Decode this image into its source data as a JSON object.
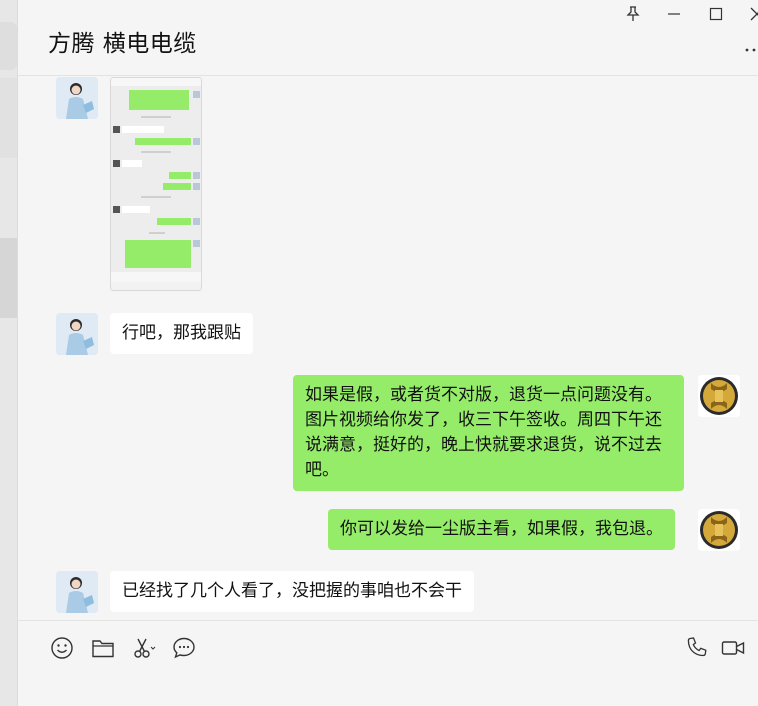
{
  "header": {
    "title": "方腾  横电电缆"
  },
  "window_controls": {
    "pin_icon": "pin-icon",
    "minimize_icon": "minimize-icon",
    "maximize_icon": "maximize-icon",
    "close_icon": "close-icon",
    "more_icon": "more-icon"
  },
  "messages": [
    {
      "side": "left",
      "type": "image",
      "sender_avatar": "girl-avatar"
    },
    {
      "side": "left",
      "type": "text",
      "text": "行吧，那我跟贴"
    },
    {
      "side": "right",
      "type": "text",
      "text": "如果是假，或者货不对版，退货一点问题没有。图片视频给你发了，收三下午签收。周四下午还说满意，挺好的，晚上快就要求退货，说不过去吧。"
    },
    {
      "side": "right",
      "type": "text",
      "text": "你可以发给一尘版主看，如果假，我包退。"
    },
    {
      "side": "left",
      "type": "text",
      "text": "已经找了几个人看了，没把握的事咱也不会干"
    }
  ],
  "toolbar": {
    "icons": [
      "emoji-icon",
      "folder-icon",
      "scissors-icon",
      "chat-bubble-icon",
      "phone-icon",
      "video-icon"
    ]
  },
  "colors": {
    "bubble_self": "#95ec69",
    "bubble_other": "#ffffff",
    "background": "#f5f5f5"
  }
}
